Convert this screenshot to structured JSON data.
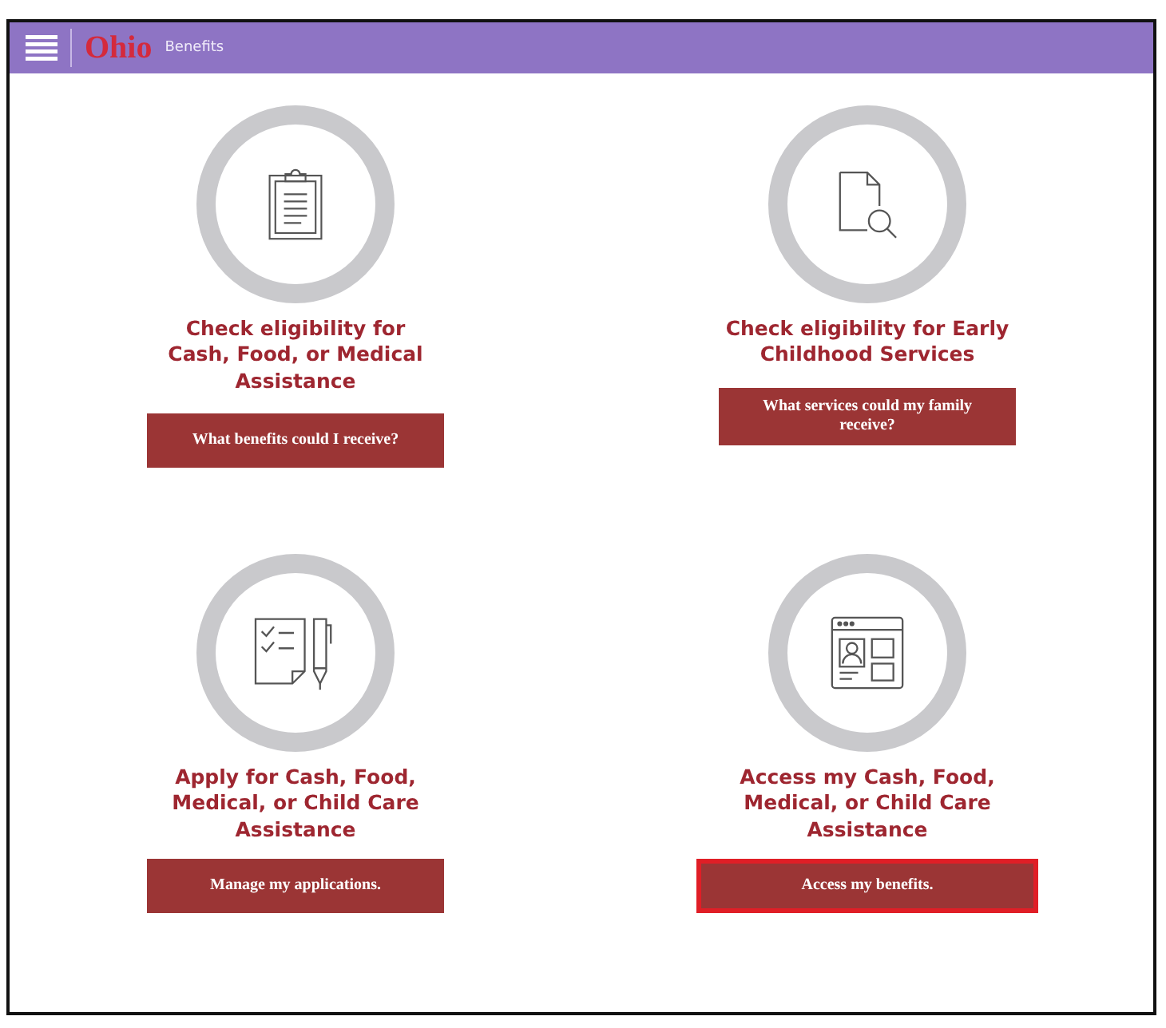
{
  "header": {
    "logo": "Ohio",
    "subtitle": "Benefits"
  },
  "cards": [
    {
      "kind": "clipboard",
      "title": "Check eligibility for Cash, Food, or Medical Assistance",
      "button": {
        "label": "What benefits could I receive?",
        "focused": false
      }
    },
    {
      "kind": "search",
      "title": "Check eligibility for Early Childhood Services",
      "button": {
        "label": "What services could my family receive?",
        "focused": false
      }
    },
    {
      "kind": "checklist",
      "title": "Apply for Cash, Food, Medical, or Child Care Assistance",
      "button": {
        "label": "Manage my applications.",
        "focused": false
      }
    },
    {
      "kind": "profile",
      "title": "Access my Cash, Food, Medical, or Child Care Assistance",
      "button": {
        "label": "Access my benefits.",
        "focused": true
      }
    }
  ]
}
